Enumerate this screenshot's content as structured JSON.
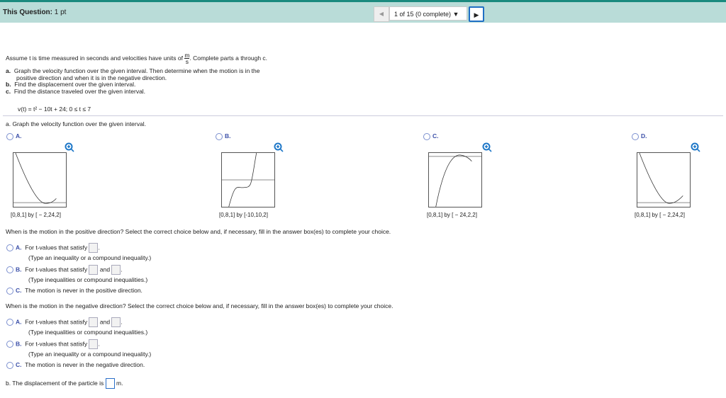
{
  "header": {
    "question_label": "This Question:",
    "points": "1 pt",
    "progress": "1 of 15 (0 complete)"
  },
  "problem": {
    "intro_pre": "Assume t is time measured in seconds and velocities have units of",
    "unit_num": "m",
    "unit_den": "s",
    "intro_post": ". Complete parts a through c.",
    "parts": [
      {
        "letter": "a.",
        "text": "Graph the velocity function over the given interval. Then determine when the motion is in the",
        "text2": "positive direction and when it is in the negative direction."
      },
      {
        "letter": "b.",
        "text": "Find the displacement over the given interval."
      },
      {
        "letter": "c.",
        "text": "Find the distance traveled over the given interval."
      }
    ],
    "function": "v(t) = t² − 10t + 24; 0 ≤ t ≤ 7"
  },
  "part_a": {
    "prompt": "a. Graph the velocity function over the given interval.",
    "graph_options": [
      {
        "letter": "A.",
        "window": "[0,8,1] by [ − 2,24,2]"
      },
      {
        "letter": "B.",
        "window": "[0,8,1] by [-10,10,2]"
      },
      {
        "letter": "C.",
        "window": "[0,8,1] by [ − 24,2,2]"
      },
      {
        "letter": "D.",
        "window": "[0,8,1] by [ − 2,24,2]"
      }
    ]
  },
  "positive": {
    "prompt": "When is the motion in the positive direction? Select the correct choice below and, if necessary, fill in the answer box(es) to complete your choice.",
    "A": {
      "letter": "A.",
      "text": "For t-values that satisfy",
      "hint": "(Type an inequality or a compound inequality.)"
    },
    "B": {
      "letter": "B.",
      "text": "For t-values that satisfy",
      "and": "and",
      "hint": "(Type inequalities or compound inequalities.)"
    },
    "C": {
      "letter": "C.",
      "text": "The motion is never in the positive direction."
    }
  },
  "negative": {
    "prompt": "When is the motion in the negative direction? Select the correct choice below and, if necessary, fill in the answer box(es) to complete your choice.",
    "A": {
      "letter": "A.",
      "text": "For t-values that satisfy",
      "and": "and",
      "hint": "(Type inequalities or compound inequalities.)"
    },
    "B": {
      "letter": "B.",
      "text": "For t-values that satisfy",
      "hint": "(Type an inequality or a compound inequality.)"
    },
    "C": {
      "letter": "C.",
      "text": "The motion is never in the negative direction."
    }
  },
  "part_b": {
    "text": "b. The displacement of the particle is",
    "unit": "m."
  }
}
